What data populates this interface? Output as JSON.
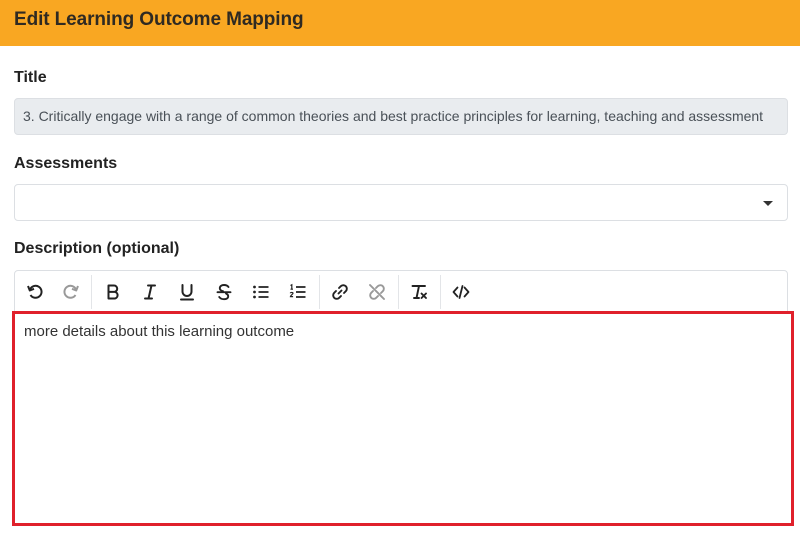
{
  "header": {
    "title": "Edit Learning Outcome Mapping"
  },
  "title_field": {
    "label": "Title",
    "value": "3. Critically engage with a range of common theories and best practice principles for learning, teaching and assessment"
  },
  "assessments_field": {
    "label": "Assessments",
    "value": ""
  },
  "description_field": {
    "label": "Description (optional)",
    "content": "more details about this learning outcome",
    "toolbar": [
      {
        "name": "undo-icon"
      },
      {
        "name": "redo-icon"
      },
      {
        "name": "bold-icon"
      },
      {
        "name": "italic-icon"
      },
      {
        "name": "underline-icon"
      },
      {
        "name": "strikethrough-icon"
      },
      {
        "name": "bullet-list-icon"
      },
      {
        "name": "numbered-list-icon"
      },
      {
        "name": "link-icon"
      },
      {
        "name": "unlink-icon"
      },
      {
        "name": "clear-format-icon"
      },
      {
        "name": "code-view-icon"
      }
    ]
  },
  "colors": {
    "header_bg": "#f9a722",
    "highlight_border": "#e0202b"
  }
}
